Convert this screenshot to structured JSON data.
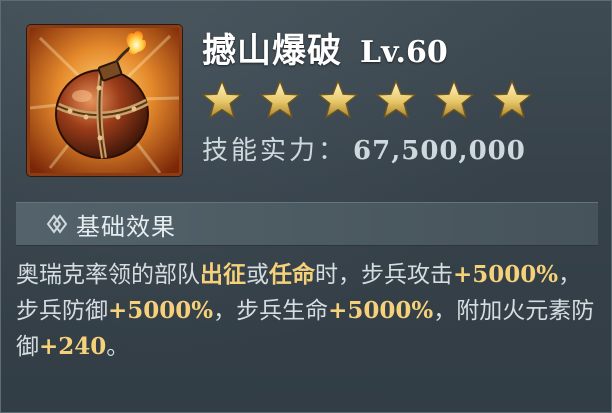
{
  "skill": {
    "name": "撼山爆破",
    "level": "Lv.60",
    "stars": 6,
    "power_label": "技能实力：",
    "power_value": "67,500,000",
    "icon": "fire-bomb-icon"
  },
  "section": {
    "title": "基础效果",
    "icon": "link-diamond-icon"
  },
  "description": {
    "t1": "奥瑞克率领的部队",
    "h1": "出征",
    "t2": "或",
    "h2": "任命",
    "t3": "时，步兵攻击",
    "n1": "+5000%",
    "t4": "，步兵防御",
    "n2": "+5000%",
    "t5": "，步兵生命",
    "n3": "+5000%",
    "t6": "，附加火元素防御",
    "n4": "+240",
    "t7": "。"
  },
  "colors": {
    "highlight": "#f5d27a",
    "star": "#e8c96a",
    "background": "#3a464e"
  }
}
